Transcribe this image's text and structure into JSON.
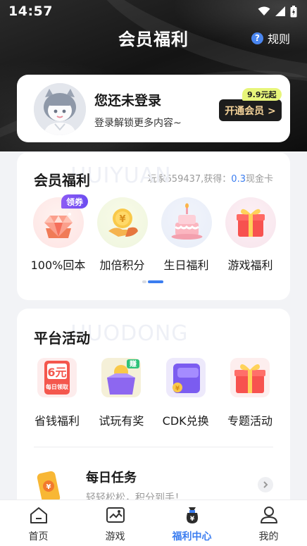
{
  "status_bar": {
    "time": "14:57"
  },
  "header": {
    "title": "会员福利",
    "rules_label": "规则",
    "help_glyph": "?"
  },
  "user_card": {
    "name": "您还未登录",
    "subtitle": "登录解锁更多内容~",
    "price_tag": "9.9元起",
    "open_vip_label": "开通会员 >"
  },
  "benefits": {
    "title": "会员福利",
    "watermark": "HUIYUAN",
    "meta_prefix": "玩家659437,获得：",
    "meta_value": "0.3",
    "meta_suffix": "现金卡",
    "badge": "领券",
    "items": [
      {
        "label": "100%回本",
        "icon": "diamond-gift-icon"
      },
      {
        "label": "加倍积分",
        "icon": "coin-hand-icon"
      },
      {
        "label": "生日福利",
        "icon": "birthday-cake-icon"
      },
      {
        "label": "游戏福利",
        "icon": "gift-box-icon"
      }
    ],
    "page_indicator": {
      "pages": 2,
      "current": 2
    }
  },
  "platform": {
    "title": "平台活动",
    "watermark": "HUODONG",
    "items": [
      {
        "label": "省钱福利",
        "icon": "red-envelope-icon",
        "icon_text": "6元",
        "icon_text2": "每日领取"
      },
      {
        "label": "试玩有奖",
        "icon": "coin-box-icon",
        "icon_text": "赚"
      },
      {
        "label": "CDK兑换",
        "icon": "cdk-card-icon"
      },
      {
        "label": "专题活动",
        "icon": "gift-box-icon"
      }
    ],
    "task": {
      "title": "每日任务",
      "subtitle": "轻轻松松，积分到手！",
      "icon": "ticket-icon"
    }
  },
  "bottom_nav": {
    "items": [
      {
        "label": "首页",
        "icon": "home-icon",
        "active": false
      },
      {
        "label": "游戏",
        "icon": "game-icon",
        "active": false
      },
      {
        "label": "福利中心",
        "icon": "benefit-bag-icon",
        "active": true
      },
      {
        "label": "我的",
        "icon": "profile-icon",
        "active": false
      }
    ]
  },
  "colors": {
    "accent": "#3b7df0",
    "vip_gold": "#f6d49a",
    "badge_purple": "#7b52f2"
  }
}
